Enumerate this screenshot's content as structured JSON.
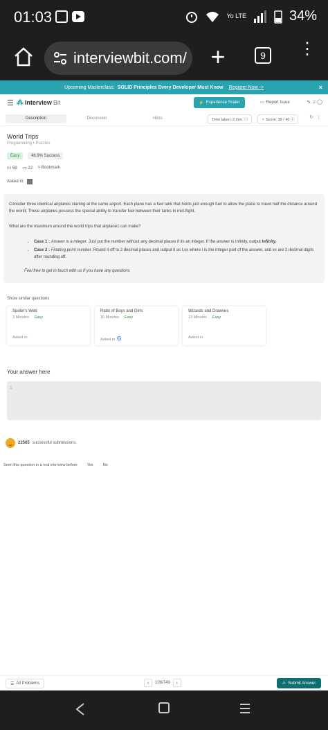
{
  "status": {
    "time": "01:03",
    "battery": "34%",
    "lte": "Yo LTE"
  },
  "browser": {
    "url": "interviewbit.com/",
    "tab_count": "9"
  },
  "banner": {
    "prefix": "Upcoming Masterclass:",
    "title": "SOLID Principles Every Developer Must Know",
    "link": "Register Now ->",
    "close": "×"
  },
  "nav": {
    "logo_main": "Interview",
    "logo_bit": "Bit",
    "experience_button": "Experience Scaler",
    "report": "Report Issue"
  },
  "tabs": {
    "description": "Description",
    "discussion": "Discussion",
    "hints": "Hints"
  },
  "timer": {
    "label": "Time taken: 2 min."
  },
  "score": {
    "label": "Score: 39 / 40"
  },
  "question": {
    "title": "World Trips",
    "category": "Programming • Puzzles",
    "difficulty": "Easy",
    "success": "46.9% Success",
    "upvotes": "59",
    "downvotes": "22",
    "bookmark": "Bookmark",
    "asked_in": "Asked In:"
  },
  "problem": {
    "para1": "Consider three identical airplanes starting at the same airport. Each plane has a fuel tank that holds just enough fuel to allow the plane to travel half the distance around the world. These airplanes possess the special ability to transfer fuel between their tanks in mid-flight.",
    "para2": "What are the maximum around the world trips that airplane1 can make?",
    "case1_label": "Case 1 :",
    "case1_italic": "Answer is a integer.",
    "case1_text": "Just put the number without any decimal places if its an integer. If the answer is Infinity, output",
    "case1_inf": "Infinity.",
    "case2_label": "Case 2 :",
    "case2_italic": "Floating point number.",
    "case2_text": "Round it off to 2 decimal places and output it as I.xx where I is the integer part of the answer, and xx are 2 decimal digits after rounding off.",
    "feel": "Feel free to get in touch with us if you have any questions"
  },
  "similar": {
    "label": "Show similar questions",
    "items": [
      {
        "name": "Spider's Web",
        "time": "3 Minutes",
        "difficulty": "Easy",
        "asked": "Asked in:"
      },
      {
        "name": "Ratio of Boys and Girls",
        "time": "15 Minutes",
        "difficulty": "Easy",
        "asked": "Asked in:"
      },
      {
        "name": "Wizards and Drawves",
        "time": "13 Minutes",
        "difficulty": "Easy",
        "asked": "Asked in:"
      }
    ]
  },
  "answer": {
    "label": "Your answer here",
    "line_number": "1"
  },
  "submissions": {
    "count": "22565",
    "text": "successful submissions."
  },
  "seen": {
    "question": "Seen this question in a real interview before",
    "yes": "Yes",
    "no": "No"
  },
  "footer": {
    "all_problems": "All Problems",
    "page": "108/749",
    "submit": "Submit Answer"
  }
}
